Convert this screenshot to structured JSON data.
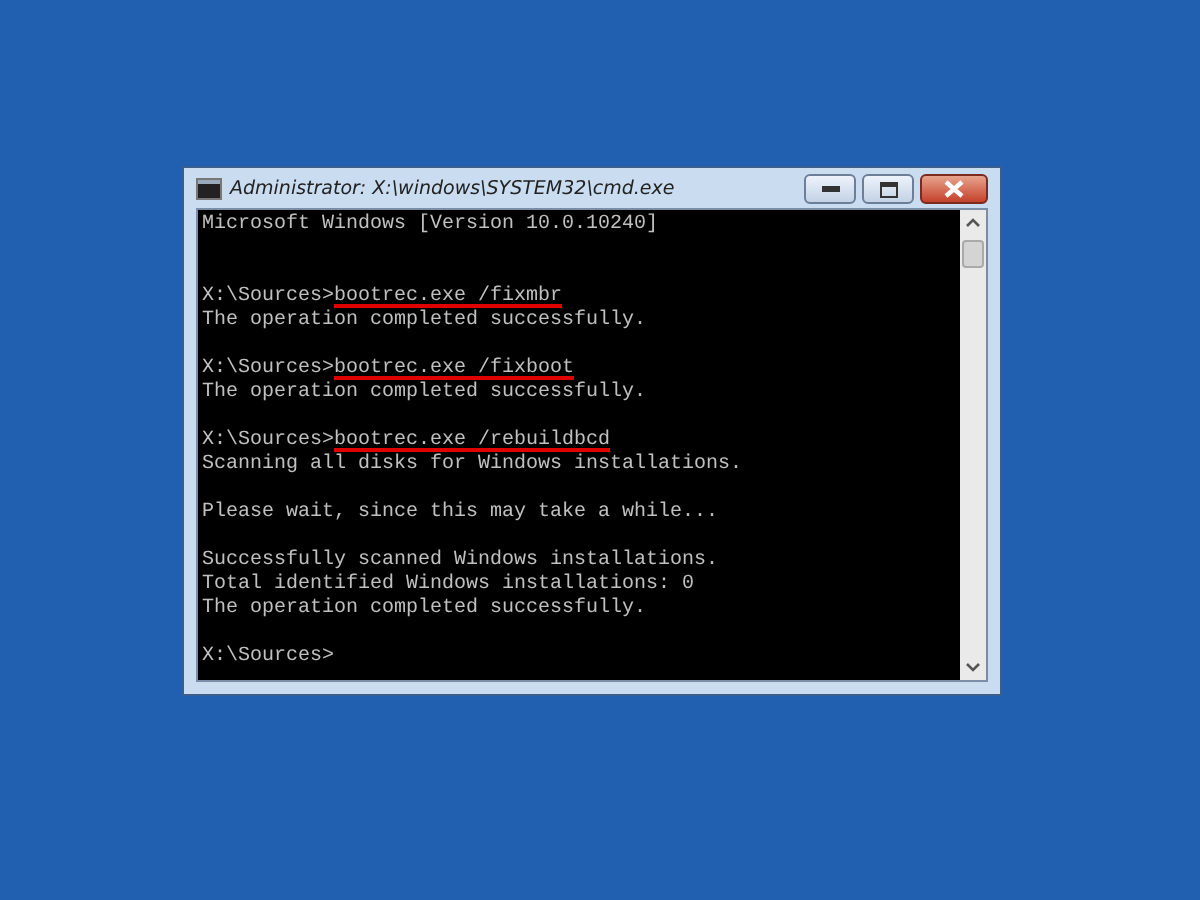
{
  "window": {
    "title": "Administrator: X:\\windows\\SYSTEM32\\cmd.exe"
  },
  "console": {
    "lines": [
      {
        "kind": "output",
        "text": "Microsoft Windows [Version 10.0.10240]"
      },
      {
        "kind": "blank"
      },
      {
        "kind": "blank"
      },
      {
        "kind": "prompt",
        "prompt": "X:\\Sources>",
        "command": "bootrec.exe /fixmbr",
        "underlined": true
      },
      {
        "kind": "output",
        "text": "The operation completed successfully."
      },
      {
        "kind": "blank"
      },
      {
        "kind": "prompt",
        "prompt": "X:\\Sources>",
        "command": "bootrec.exe /fixboot",
        "underlined": true
      },
      {
        "kind": "output",
        "text": "The operation completed successfully."
      },
      {
        "kind": "blank"
      },
      {
        "kind": "prompt",
        "prompt": "X:\\Sources>",
        "command": "bootrec.exe /rebuildbcd",
        "underlined": true
      },
      {
        "kind": "output",
        "text": "Scanning all disks for Windows installations."
      },
      {
        "kind": "blank"
      },
      {
        "kind": "output",
        "text": "Please wait, since this may take a while..."
      },
      {
        "kind": "blank"
      },
      {
        "kind": "output",
        "text": "Successfully scanned Windows installations."
      },
      {
        "kind": "output",
        "text": "Total identified Windows installations: 0"
      },
      {
        "kind": "output",
        "text": "The operation completed successfully."
      },
      {
        "kind": "blank"
      },
      {
        "kind": "prompt",
        "prompt": "X:\\Sources>"
      }
    ]
  }
}
